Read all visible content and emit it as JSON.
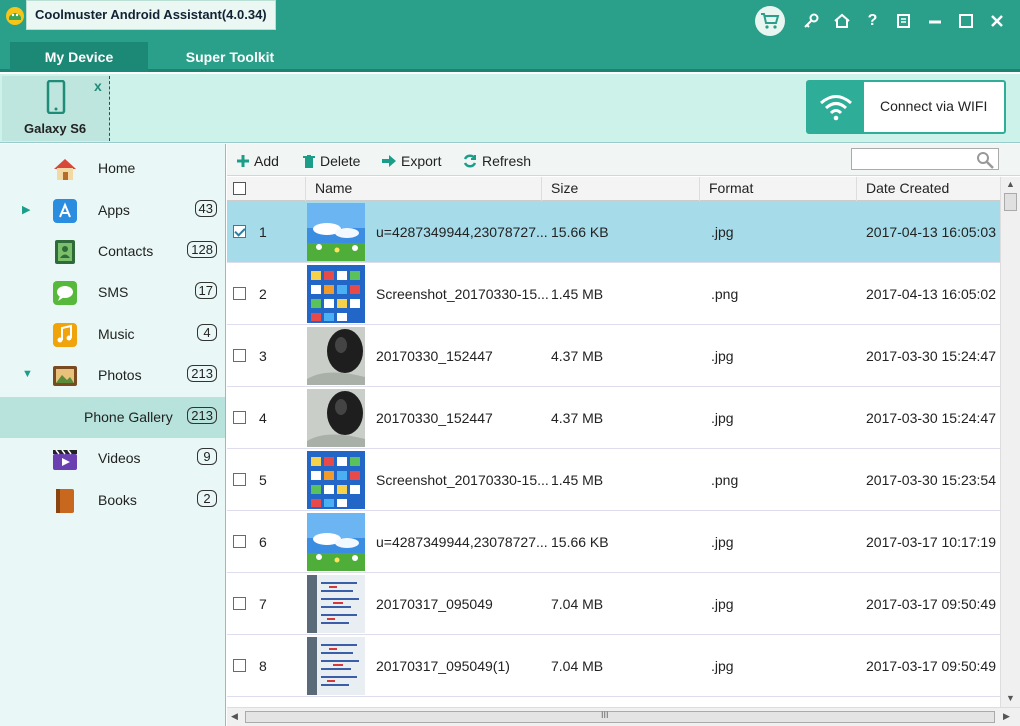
{
  "app": {
    "title": "Coolmuster Android Assistant(4.0.34)"
  },
  "tabs": [
    {
      "label": "My Device"
    },
    {
      "label": "Super Toolkit"
    }
  ],
  "device": {
    "name": "Galaxy S6",
    "close": "x"
  },
  "wifi": {
    "label": "Connect via WIFI"
  },
  "sidebar": {
    "items": [
      {
        "label": "Home",
        "count": ""
      },
      {
        "label": "Apps",
        "count": "43"
      },
      {
        "label": "Contacts",
        "count": "128"
      },
      {
        "label": "SMS",
        "count": "17"
      },
      {
        "label": "Music",
        "count": "4"
      },
      {
        "label": "Photos",
        "count": "213"
      },
      {
        "label": "Phone Gallery",
        "count": "213"
      },
      {
        "label": "Videos",
        "count": "9"
      },
      {
        "label": "Books",
        "count": "2"
      }
    ]
  },
  "toolbar": {
    "add": "Add",
    "delete": "Delete",
    "export": "Export",
    "refresh": "Refresh",
    "search_placeholder": ""
  },
  "table": {
    "headers": {
      "name": "Name",
      "size": "Size",
      "format": "Format",
      "date": "Date Created"
    },
    "rows": [
      {
        "num": "1",
        "name": "u=4287349944,23078727...",
        "size": "15.66 KB",
        "format": ".jpg",
        "date": "2017-04-13 16:05:03",
        "checked": true,
        "thumb": "sky"
      },
      {
        "num": "2",
        "name": "Screenshot_20170330-15...",
        "size": "1.45 MB",
        "format": ".png",
        "date": "2017-04-13 16:05:02",
        "checked": false,
        "thumb": "screen"
      },
      {
        "num": "3",
        "name": "20170330_152447",
        "size": "4.37 MB",
        "format": ".jpg",
        "date": "2017-03-30 15:24:47",
        "checked": false,
        "thumb": "mouse"
      },
      {
        "num": "4",
        "name": "20170330_152447",
        "size": "4.37 MB",
        "format": ".jpg",
        "date": "2017-03-30 15:24:47",
        "checked": false,
        "thumb": "mouse"
      },
      {
        "num": "5",
        "name": "Screenshot_20170330-15...",
        "size": "1.45 MB",
        "format": ".png",
        "date": "2017-03-30 15:23:54",
        "checked": false,
        "thumb": "screen"
      },
      {
        "num": "6",
        "name": "u=4287349944,23078727...",
        "size": "15.66 KB",
        "format": ".jpg",
        "date": "2017-03-17 10:17:19",
        "checked": false,
        "thumb": "sky"
      },
      {
        "num": "7",
        "name": "20170317_095049",
        "size": "7.04 MB",
        "format": ".jpg",
        "date": "2017-03-17 09:50:49",
        "checked": false,
        "thumb": "paper"
      },
      {
        "num": "8",
        "name": "20170317_095049(1)",
        "size": "7.04 MB",
        "format": ".jpg",
        "date": "2017-03-17 09:50:49",
        "checked": false,
        "thumb": "paper"
      }
    ]
  },
  "colors": {
    "accent": "#2a9f8a",
    "selected_row": "#a6dcea",
    "sidebar_selected": "#b7e3dc"
  },
  "scrollbar": {
    "h_thumb_label": "III"
  }
}
